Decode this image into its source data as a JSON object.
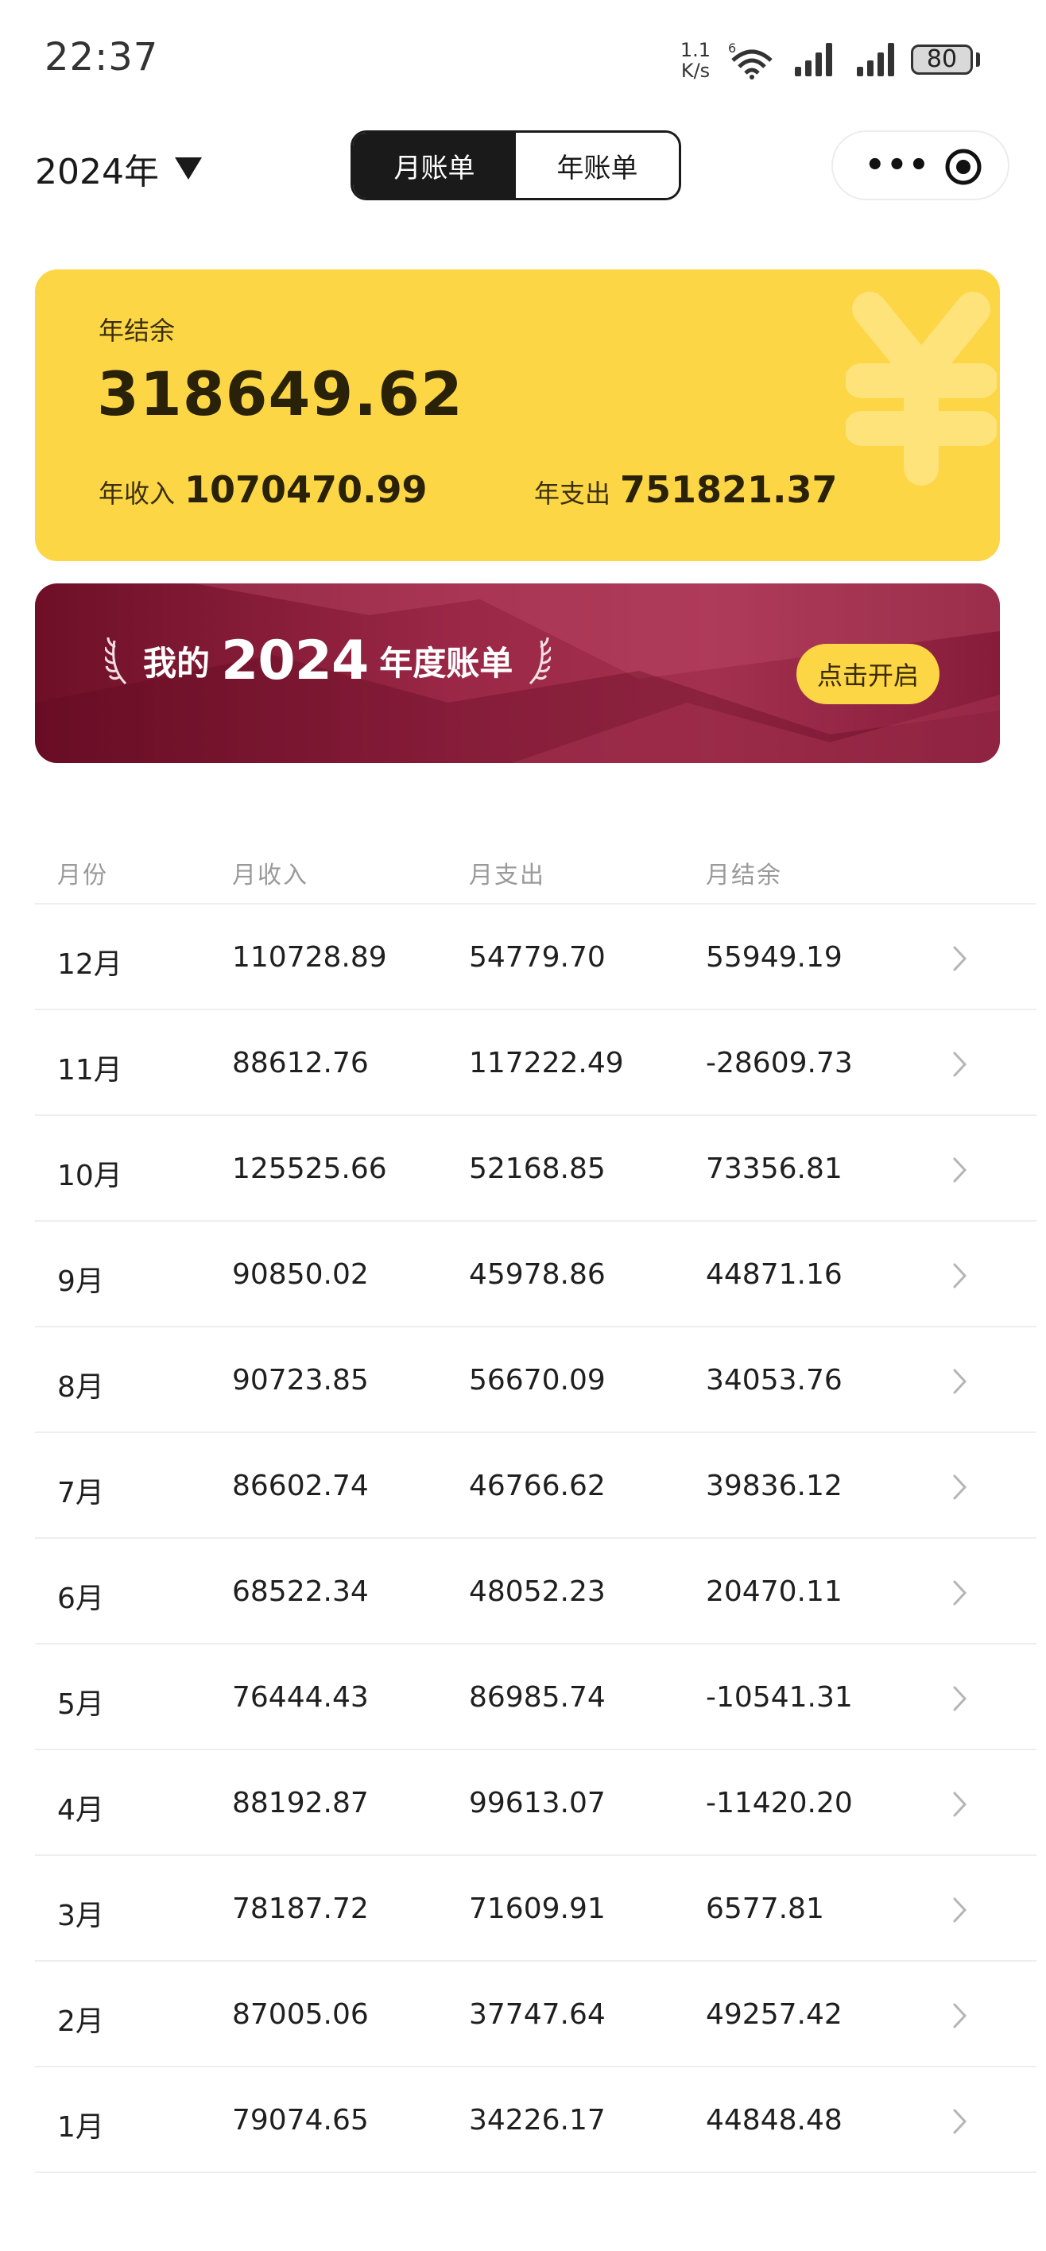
{
  "status_bar": {
    "time": "22:37",
    "net_speed_value": "1.1",
    "net_speed_unit": "K/s",
    "battery": "80",
    "icons": [
      "wifi-6-icon",
      "signal-icon",
      "signal-icon"
    ]
  },
  "header": {
    "year": "2024年",
    "tabs": [
      {
        "label": "月账单",
        "active": true
      },
      {
        "label": "年账单",
        "active": false
      }
    ],
    "capsule_icons": [
      "more-icon",
      "target-icon"
    ]
  },
  "summary": {
    "balance_label": "年结余",
    "balance_value": "318649.62",
    "income_label": "年收入",
    "income_value": "1070470.99",
    "expense_label": "年支出",
    "expense_value": "751821.37",
    "accent_color": "#fdd645",
    "watermark_icon": "yen-icon"
  },
  "banner": {
    "title_prefix": "我的",
    "title_year": "2024",
    "title_suffix": "年度账单",
    "button_label": "点击开启",
    "color": "#9c2848"
  },
  "table": {
    "headers": [
      "月份",
      "月收入",
      "月支出",
      "月结余"
    ],
    "rows": [
      {
        "month": "12月",
        "income": "110728.89",
        "expense": "54779.70",
        "balance": "55949.19"
      },
      {
        "month": "11月",
        "income": "88612.76",
        "expense": "117222.49",
        "balance": "-28609.73"
      },
      {
        "month": "10月",
        "income": "125525.66",
        "expense": "52168.85",
        "balance": "73356.81"
      },
      {
        "month": "9月",
        "income": "90850.02",
        "expense": "45978.86",
        "balance": "44871.16"
      },
      {
        "month": "8月",
        "income": "90723.85",
        "expense": "56670.09",
        "balance": "34053.76"
      },
      {
        "month": "7月",
        "income": "86602.74",
        "expense": "46766.62",
        "balance": "39836.12"
      },
      {
        "month": "6月",
        "income": "68522.34",
        "expense": "48052.23",
        "balance": "20470.11"
      },
      {
        "month": "5月",
        "income": "76444.43",
        "expense": "86985.74",
        "balance": "-10541.31"
      },
      {
        "month": "4月",
        "income": "88192.87",
        "expense": "99613.07",
        "balance": "-11420.20"
      },
      {
        "month": "3月",
        "income": "78187.72",
        "expense": "71609.91",
        "balance": "6577.81"
      },
      {
        "month": "2月",
        "income": "87005.06",
        "expense": "37747.64",
        "balance": "49257.42"
      },
      {
        "month": "1月",
        "income": "79074.65",
        "expense": "34226.17",
        "balance": "44848.48"
      }
    ]
  }
}
